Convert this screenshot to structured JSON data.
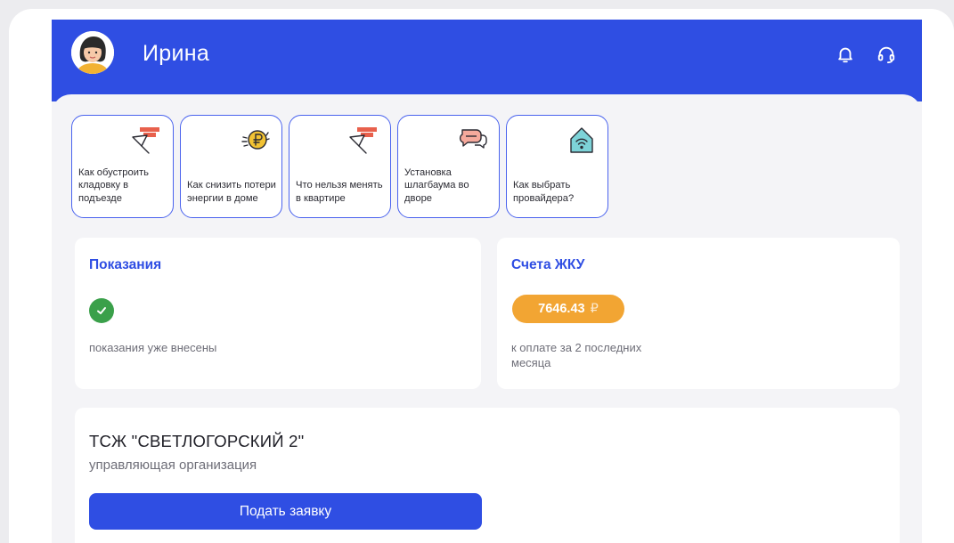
{
  "header": {
    "user_name": "Ирина",
    "bg_color": "#2f4ee3",
    "icons": [
      "bell-icon",
      "support-headset-icon"
    ]
  },
  "stories": [
    {
      "label": "Как обустроить кладовку в подъезде",
      "icon": "brick-trowel-icon"
    },
    {
      "label": "Как снизить потери энергии в доме",
      "icon": "ruble-coin-icon"
    },
    {
      "label": "Что нельзя менять в квартире",
      "icon": "brick-trowel-icon"
    },
    {
      "label": "Установка шлагбаума во дворе",
      "icon": "chat-bubbles-icon"
    },
    {
      "label": "Как выбрать провайдера?",
      "icon": "house-wifi-icon"
    }
  ],
  "readings": {
    "title": "Показания",
    "status_text": "показания уже внесены",
    "status_icon": "check-icon",
    "status_color": "#3aa04a"
  },
  "bills": {
    "title": "Счета ЖКУ",
    "amount": "7646.43",
    "currency": "₽",
    "amount_color": "#f2a533",
    "description": "к оплате за 2 последних месяца"
  },
  "organization": {
    "name": "ТСЖ \"СВЕТЛОГОРСКИЙ 2\"",
    "role": "управляющая организация",
    "button_label": "Подать заявку"
  }
}
